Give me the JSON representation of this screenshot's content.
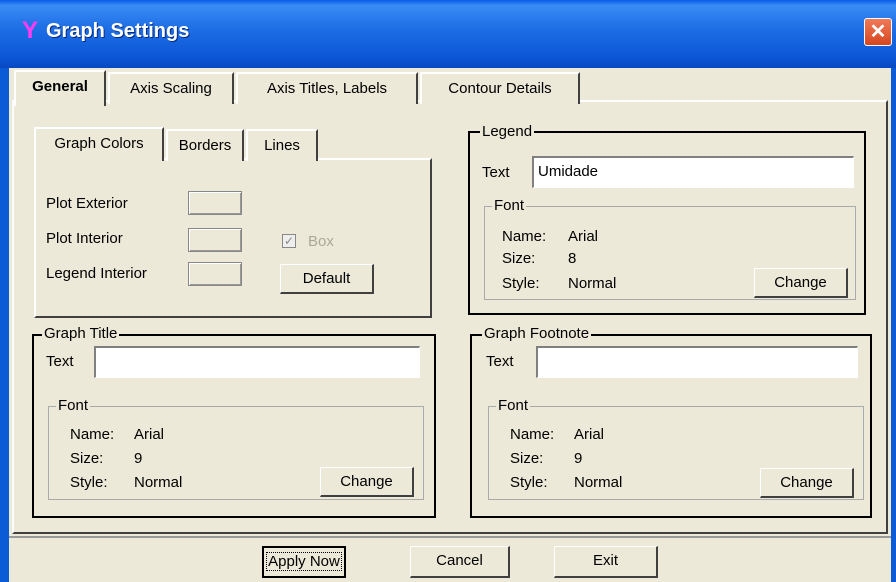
{
  "window": {
    "title": "Graph Settings",
    "close_glyph": "✕"
  },
  "tabs": [
    {
      "label": "General",
      "selected": true
    },
    {
      "label": "Axis Scaling",
      "selected": false
    },
    {
      "label": "Axis Titles, Labels",
      "selected": false
    },
    {
      "label": "Contour Details",
      "selected": false
    }
  ],
  "subtabs": [
    {
      "label": "Graph Colors",
      "selected": true
    },
    {
      "label": "Borders",
      "selected": false
    },
    {
      "label": "Lines",
      "selected": false
    }
  ],
  "graph_colors": {
    "plot_exterior_label": "Plot Exterior",
    "plot_interior_label": "Plot Interior",
    "legend_interior_label": "Legend Interior",
    "box_label": "Box",
    "box_checked": true,
    "box_enabled": false,
    "default_button": "Default"
  },
  "legend": {
    "group_label": "Legend",
    "text_label": "Text",
    "text_value": "Umidade",
    "font_group_label": "Font",
    "name_label": "Name:",
    "name_value": "Arial",
    "size_label": "Size:",
    "size_value": "8",
    "style_label": "Style:",
    "style_value": "Normal",
    "change_button": "Change"
  },
  "graph_title": {
    "group_label": "Graph Title",
    "text_label": "Text",
    "text_value": "",
    "font_group_label": "Font",
    "name_label": "Name:",
    "name_value": "Arial",
    "size_label": "Size:",
    "size_value": "9",
    "style_label": "Style:",
    "style_value": "Normal",
    "change_button": "Change"
  },
  "graph_footnote": {
    "group_label": "Graph Footnote",
    "text_label": "Text",
    "text_value": "",
    "font_group_label": "Font",
    "name_label": "Name:",
    "name_value": "Arial",
    "size_label": "Size:",
    "size_value": "9",
    "style_label": "Style:",
    "style_value": "Normal",
    "change_button": "Change"
  },
  "footer": {
    "apply_button": "Apply Now",
    "cancel_button": "Cancel",
    "exit_button": "Exit"
  }
}
